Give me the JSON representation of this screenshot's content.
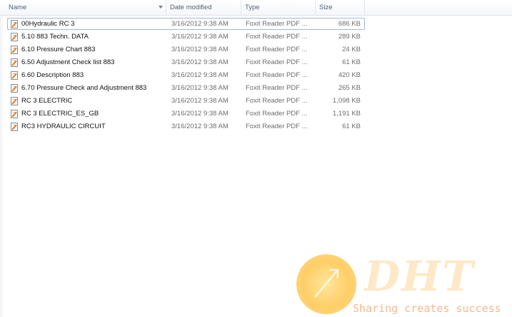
{
  "columns": {
    "name": "Name",
    "date": "Date modified",
    "type": "Type",
    "size": "Size"
  },
  "files": [
    {
      "name": "00Hydraulic RC 3",
      "date": "3/16/2012 9:38 AM",
      "type": "Foxit Reader PDF ...",
      "size": "686 KB"
    },
    {
      "name": "5.10 883 Techn. DATA",
      "date": "3/16/2012 9:38 AM",
      "type": "Foxit Reader PDF ...",
      "size": "289 KB"
    },
    {
      "name": "6.10 Pressure Chart 883",
      "date": "3/16/2012 9:38 AM",
      "type": "Foxit Reader PDF ...",
      "size": "24 KB"
    },
    {
      "name": "6.50 Adjustment Check list 883",
      "date": "3/16/2012 9:38 AM",
      "type": "Foxit Reader PDF ...",
      "size": "61 KB"
    },
    {
      "name": "6.60 Description 883",
      "date": "3/16/2012 9:38 AM",
      "type": "Foxit Reader PDF ...",
      "size": "420 KB"
    },
    {
      "name": "6.70 Pressure Check and Adjustment 883",
      "date": "3/16/2012 9:38 AM",
      "type": "Foxit Reader PDF ...",
      "size": "265 KB"
    },
    {
      "name": "RC 3 ELECTRIC",
      "date": "3/16/2012 9:38 AM",
      "type": "Foxit Reader PDF ...",
      "size": "1,098 KB"
    },
    {
      "name": "RC 3 ELECTRIC_ES_GB",
      "date": "3/16/2012 9:38 AM",
      "type": "Foxit Reader PDF ...",
      "size": "1,191 KB"
    },
    {
      "name": "RC3 HYDRAULIC CIRCUIT",
      "date": "3/16/2012 9:38 AM",
      "type": "Foxit Reader PDF ...",
      "size": "61 KB"
    }
  ],
  "file_icon": "pdf-document-icon",
  "watermark": {
    "letters": "DHT",
    "tagline": "Sharing creates success"
  }
}
